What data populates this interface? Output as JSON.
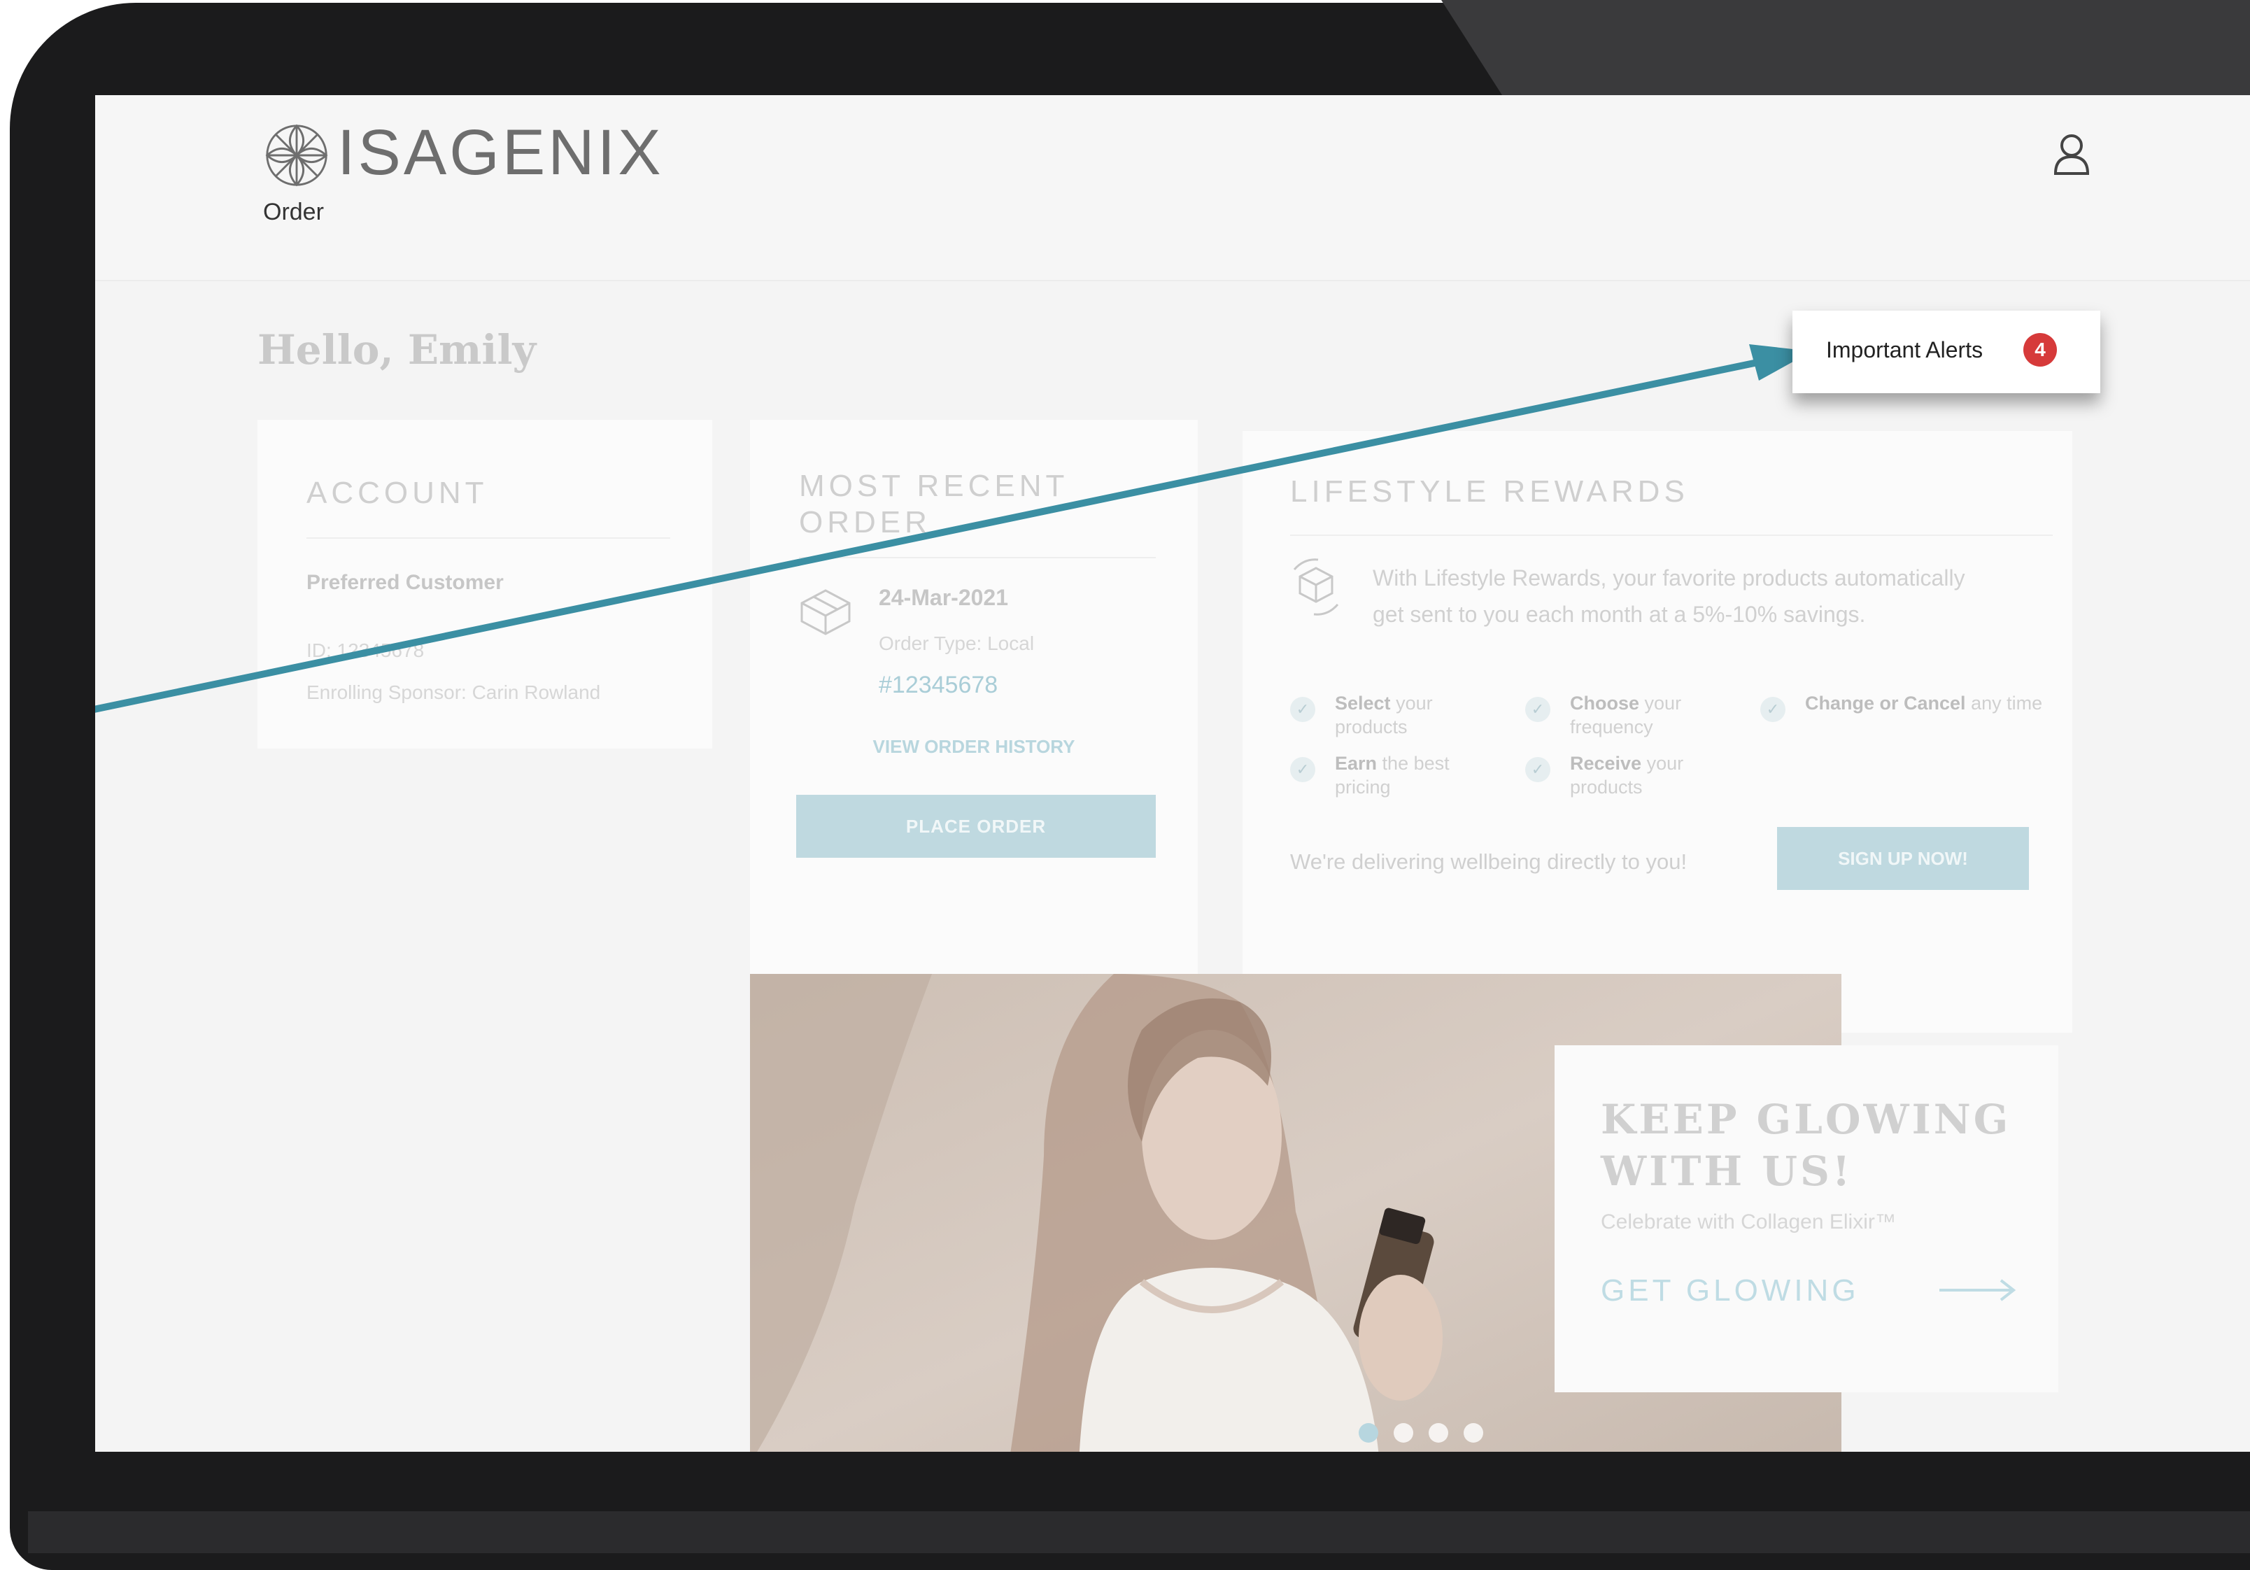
{
  "brand": {
    "name": "ISAGENIX"
  },
  "nav": {
    "order": "Order"
  },
  "greeting": "Hello, Emily",
  "alerts": {
    "label": "Important Alerts",
    "count": "4"
  },
  "account": {
    "title": "ACCOUNT",
    "type": "Preferred Customer",
    "id": "ID: 12345678",
    "sponsor": "Enrolling Sponsor: Carin Rowland"
  },
  "recent_order": {
    "title_line1": "MOST RECENT",
    "title_line2": "ORDER",
    "date": "24-Mar-2021",
    "type": "Order Type: Local",
    "number": "#12345678",
    "history_link": "VIEW ORDER HISTORY",
    "place_order": "PLACE ORDER"
  },
  "rewards": {
    "title": "LIFESTYLE REWARDS",
    "description": "With Lifestyle Rewards, your favorite products automatically get sent to you each month at a 5%-10% savings.",
    "features": [
      {
        "bold": "Select",
        "rest": "your products"
      },
      {
        "bold": "Choose",
        "rest": "your frequency"
      },
      {
        "bold": "Change or Cancel",
        "rest": "any time"
      },
      {
        "bold": "Earn",
        "rest": "the best pricing"
      },
      {
        "bold": "Receive",
        "rest": "your products"
      }
    ],
    "tagline": "We're delivering wellbeing directly to you!",
    "signup": "SIGN UP NOW!"
  },
  "promo": {
    "headline_line1": "KEEP GLOWING",
    "headline_line2": "WITH US!",
    "subtitle": "Celebrate with Collagen Elixir™",
    "cta": "GET GLOWING"
  },
  "carousel": {
    "active_index": 0,
    "count": 4
  }
}
